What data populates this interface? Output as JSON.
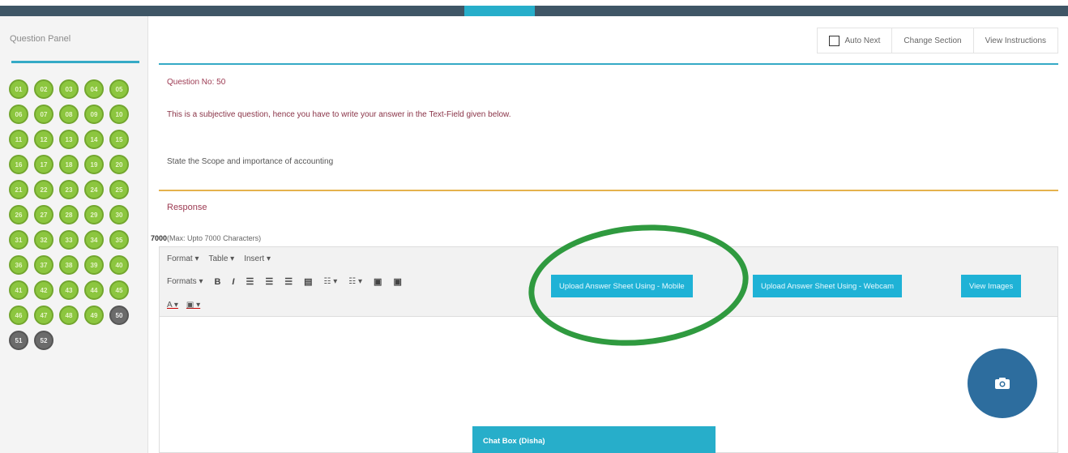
{
  "panel": {
    "title": "Question Panel",
    "questions": [
      {
        "num": "01",
        "state": "answered"
      },
      {
        "num": "02",
        "state": "answered"
      },
      {
        "num": "03",
        "state": "answered"
      },
      {
        "num": "04",
        "state": "answered"
      },
      {
        "num": "05",
        "state": "answered"
      },
      {
        "num": "06",
        "state": "answered"
      },
      {
        "num": "07",
        "state": "answered"
      },
      {
        "num": "08",
        "state": "answered"
      },
      {
        "num": "09",
        "state": "answered"
      },
      {
        "num": "10",
        "state": "answered"
      },
      {
        "num": "11",
        "state": "answered"
      },
      {
        "num": "12",
        "state": "answered"
      },
      {
        "num": "13",
        "state": "answered"
      },
      {
        "num": "14",
        "state": "answered"
      },
      {
        "num": "15",
        "state": "answered"
      },
      {
        "num": "16",
        "state": "answered"
      },
      {
        "num": "17",
        "state": "answered"
      },
      {
        "num": "18",
        "state": "answered"
      },
      {
        "num": "19",
        "state": "answered"
      },
      {
        "num": "20",
        "state": "answered"
      },
      {
        "num": "21",
        "state": "answered"
      },
      {
        "num": "22",
        "state": "answered"
      },
      {
        "num": "23",
        "state": "answered"
      },
      {
        "num": "24",
        "state": "answered"
      },
      {
        "num": "25",
        "state": "answered"
      },
      {
        "num": "26",
        "state": "answered"
      },
      {
        "num": "27",
        "state": "answered"
      },
      {
        "num": "28",
        "state": "answered"
      },
      {
        "num": "29",
        "state": "answered"
      },
      {
        "num": "30",
        "state": "answered"
      },
      {
        "num": "31",
        "state": "answered"
      },
      {
        "num": "32",
        "state": "answered"
      },
      {
        "num": "33",
        "state": "answered"
      },
      {
        "num": "34",
        "state": "answered"
      },
      {
        "num": "35",
        "state": "answered"
      },
      {
        "num": "36",
        "state": "answered"
      },
      {
        "num": "37",
        "state": "answered"
      },
      {
        "num": "38",
        "state": "answered"
      },
      {
        "num": "39",
        "state": "answered"
      },
      {
        "num": "40",
        "state": "answered"
      },
      {
        "num": "41",
        "state": "answered"
      },
      {
        "num": "42",
        "state": "answered"
      },
      {
        "num": "43",
        "state": "answered"
      },
      {
        "num": "44",
        "state": "answered"
      },
      {
        "num": "45",
        "state": "answered"
      },
      {
        "num": "46",
        "state": "answered"
      },
      {
        "num": "47",
        "state": "answered"
      },
      {
        "num": "48",
        "state": "answered"
      },
      {
        "num": "49",
        "state": "answered"
      },
      {
        "num": "50",
        "state": "current"
      },
      {
        "num": "51",
        "state": "not-visited"
      },
      {
        "num": "52",
        "state": "not-visited"
      }
    ]
  },
  "toolbar": {
    "auto_next": "Auto Next",
    "change_section": "Change Section",
    "view_instructions": "View Instructions"
  },
  "question": {
    "number_label": "Question No: 50",
    "note": "This is a subjective question, hence you have to write your answer in the Text-Field given below.",
    "text": "State the Scope and importance of accounting"
  },
  "response": {
    "label": "Response",
    "counter_value": "7000",
    "counter_note": "(Max: Upto 7000 Characters)"
  },
  "editor": {
    "menus": [
      "Format ▾",
      "Table ▾",
      "Insert ▾"
    ],
    "formats_label": "Formats ▾",
    "upload_mobile": "Upload Answer Sheet Using - Mobile",
    "upload_webcam": "Upload Answer Sheet Using - Webcam",
    "view_images": "View Images"
  },
  "chat": {
    "title": "Chat Box (Disha)"
  },
  "colors": {
    "topbar": "#3f5666",
    "accent": "#27aeca",
    "answered": "#8cc63f",
    "not_visited": "#6b6b6b",
    "highlight_circle": "#2f9a3f",
    "camera_button": "#2d6d9e"
  }
}
